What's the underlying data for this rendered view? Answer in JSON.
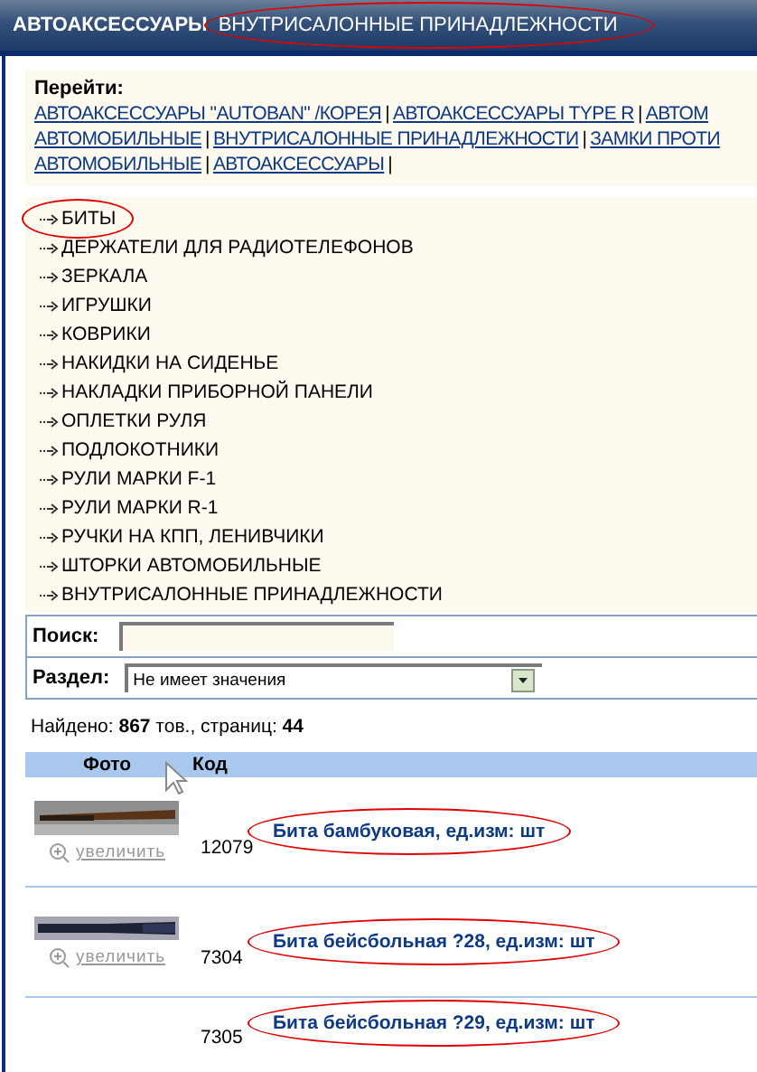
{
  "header": {
    "section": "АВТОАКСЕССУАРЫ",
    "subsection": "ВНУТРИСАЛОННЫЕ ПРИНАДЛЕЖНОСТИ",
    "subsection_circled": true
  },
  "goto": {
    "label": "Перейти:",
    "lines": [
      [
        {
          "kind": "link",
          "text": "АВТОАКСЕССУАРЫ \"AUTOBAN\" /КОРЕЯ"
        },
        {
          "kind": "separator",
          "text": "|"
        },
        {
          "kind": "link",
          "text": "АВТОАКСЕССУАРЫ TYPE R"
        },
        {
          "kind": "separator",
          "text": "|"
        },
        {
          "kind": "link",
          "text": "АВТОМ"
        }
      ],
      [
        {
          "kind": "link",
          "text": "АВТОМОБИЛЬНЫЕ"
        },
        {
          "kind": "separator",
          "text": "|"
        },
        {
          "kind": "link",
          "text": "ВНУТРИСАЛОННЫЕ ПРИНАДЛЕЖНОСТИ"
        },
        {
          "kind": "separator",
          "text": "|"
        },
        {
          "kind": "link",
          "text": "ЗАМКИ ПРОТИ"
        }
      ],
      [
        {
          "kind": "link",
          "text": "АВТОМОБИЛЬНЫЕ"
        },
        {
          "kind": "separator",
          "text": "|"
        },
        {
          "kind": "link",
          "text": "АВТОАКСЕССУАРЫ"
        },
        {
          "kind": "separator",
          "text": "|"
        }
      ]
    ]
  },
  "categories": [
    {
      "label": "БИТЫ",
      "circled": true
    },
    {
      "label": "ДЕРЖАТЕЛИ ДЛЯ РАДИОТЕЛЕФОНОВ",
      "circled": false
    },
    {
      "label": "ЗЕРКАЛА",
      "circled": false
    },
    {
      "label": "ИГРУШКИ",
      "circled": false
    },
    {
      "label": "КОВРИКИ",
      "circled": false
    },
    {
      "label": "НАКИДКИ НА СИДЕНЬЕ",
      "circled": false
    },
    {
      "label": "НАКЛАДКИ ПРИБОРНОЙ ПАНЕЛИ",
      "circled": false
    },
    {
      "label": "ОПЛЕТКИ РУЛЯ",
      "circled": false
    },
    {
      "label": "ПОДЛОКОТНИКИ",
      "circled": false
    },
    {
      "label": "РУЛИ МАРКИ F-1",
      "circled": false
    },
    {
      "label": "РУЛИ МАРКИ R-1",
      "circled": false
    },
    {
      "label": "РУЧКИ НА КПП, ЛЕНИВЧИКИ",
      "circled": false
    },
    {
      "label": "ШТОРКИ АВТОМОБИЛЬНЫЕ",
      "circled": false
    },
    {
      "label": "ВНУТРИСАЛОННЫЕ ПРИНАДЛЕЖНОСТИ",
      "circled": false
    }
  ],
  "search": {
    "search_label": "Поиск:",
    "section_label": "Раздел:",
    "section_value": "Не имеет значения"
  },
  "found": "Найдено: **867** тов., страниц: **44**",
  "table": {
    "columns": [
      "Фото",
      "Код"
    ],
    "rows": [
      {
        "photo": true,
        "zoom": "увеличить",
        "code": "12079",
        "name": "Бита бамбуковая, ед.изм: шт",
        "circled": true
      },
      {
        "photo": true,
        "zoom": "увеличить",
        "code": "7304",
        "name": "Бита бейсбольная ?28, ед.изм: шт",
        "circled": true
      },
      {
        "photo": false,
        "code": "7305",
        "name": "Бита бейсбольная ?29, ед.изм: шт",
        "circled": true
      }
    ]
  }
}
